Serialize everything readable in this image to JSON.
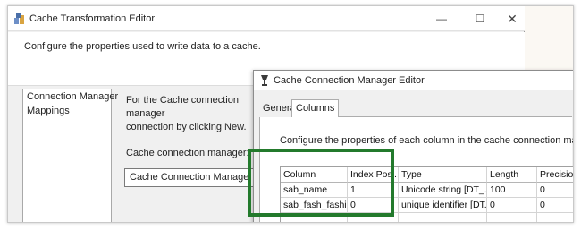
{
  "outer_window": {
    "title": "Cache Transformation Editor",
    "description": "Configure the properties used to write data to a cache.",
    "nav_items": [
      "Connection Manager",
      "Mappings"
    ],
    "info_text": "For the Cache connection manager\nconnection by clicking New.",
    "ccm_label": "Cache connection manager:",
    "ccm_value": "Cache Connection Manager",
    "controls": {
      "minimize": "—",
      "maximize": "☐",
      "close": "✕"
    }
  },
  "inner_dialog": {
    "title": "Cache Connection Manager Editor",
    "tabs": [
      "General",
      "Columns"
    ],
    "description": "Configure the properties of each column in the cache connection manager.",
    "grid": {
      "headers": [
        "Column",
        "Index Posi...",
        "Type",
        "Length",
        "Precision"
      ],
      "rows": [
        [
          "sab_name",
          "1",
          "Unicode string [DT_...",
          "100",
          "0"
        ],
        [
          "sab_fash_fashi...",
          "0",
          "unique identifier [DT...",
          "0",
          "0"
        ]
      ]
    }
  },
  "colors": {
    "highlight": "#237a2c",
    "window_bg": "#f0f0f0",
    "panel_bg": "#ffffff"
  }
}
